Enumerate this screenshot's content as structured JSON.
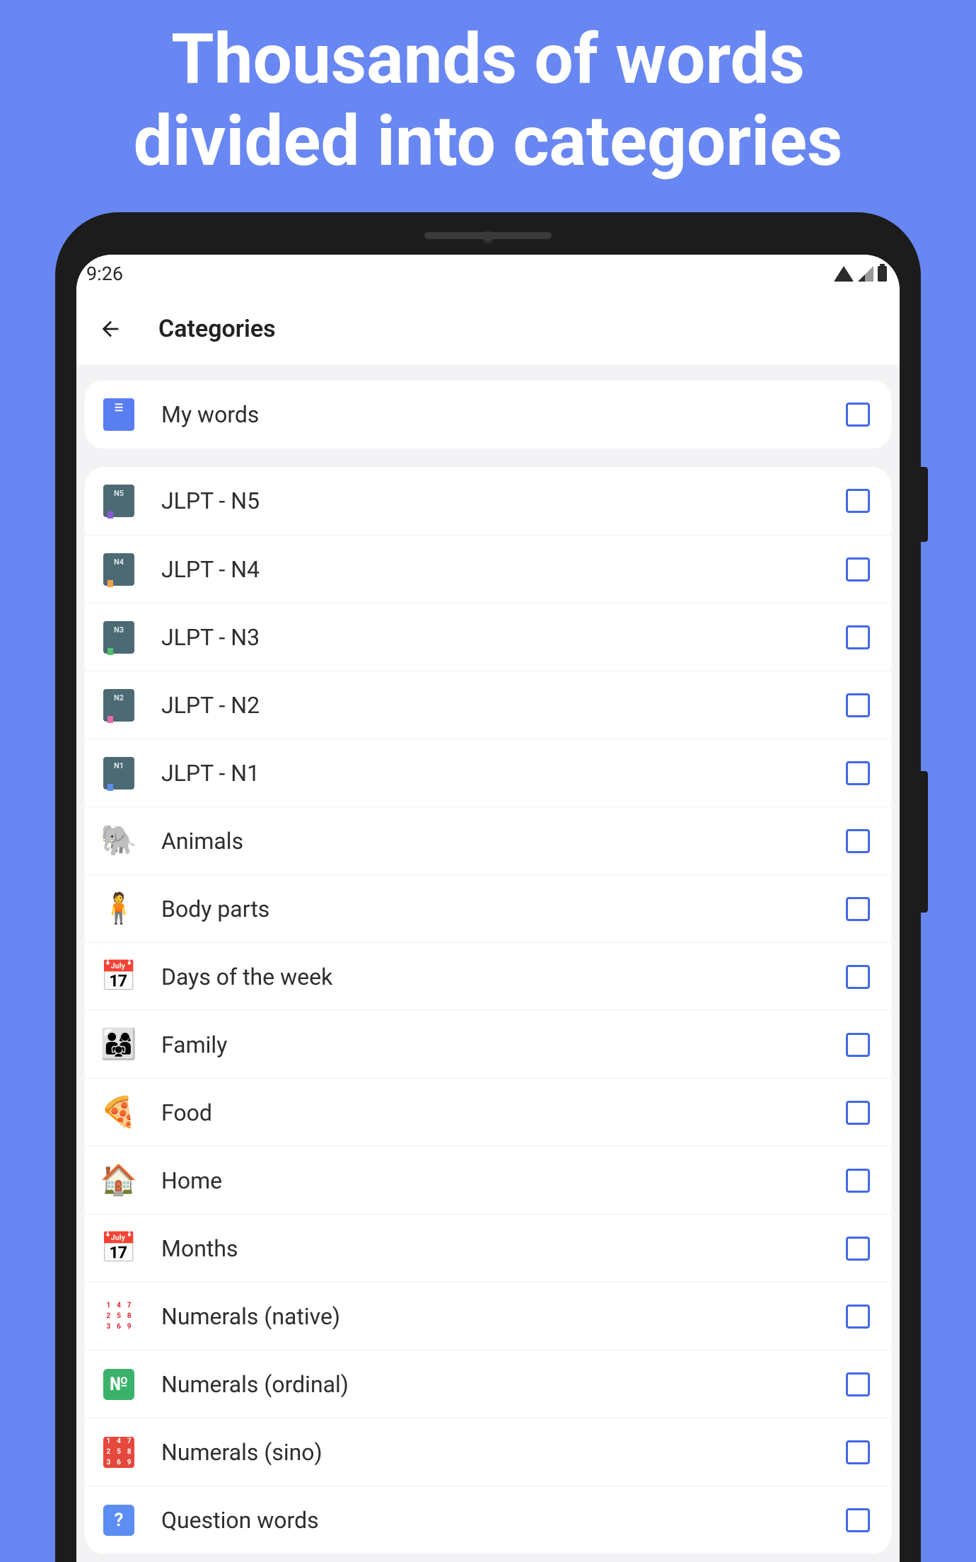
{
  "hero": {
    "line1": "Thousands of words",
    "line2": "divided into categories"
  },
  "statusbar": {
    "time": "9:26"
  },
  "appbar": {
    "title": "Categories"
  },
  "my_words": {
    "label": "My words"
  },
  "categories": [
    {
      "label": "JLPT - N5",
      "icon_type": "book",
      "book_text": "N5",
      "ribbon": "purple"
    },
    {
      "label": "JLPT - N4",
      "icon_type": "book",
      "book_text": "N4",
      "ribbon": "orange"
    },
    {
      "label": "JLPT - N3",
      "icon_type": "book",
      "book_text": "N3",
      "ribbon": "green"
    },
    {
      "label": "JLPT - N2",
      "icon_type": "book",
      "book_text": "N2",
      "ribbon": "pink"
    },
    {
      "label": "JLPT - N1",
      "icon_type": "book",
      "book_text": "N1",
      "ribbon": "blue2"
    },
    {
      "label": "Animals",
      "icon_type": "emoji",
      "emoji": "🐘"
    },
    {
      "label": "Body parts",
      "icon_type": "emoji",
      "emoji": "🧍"
    },
    {
      "label": "Days of the week",
      "icon_type": "emoji",
      "emoji": "📅"
    },
    {
      "label": "Family",
      "icon_type": "emoji",
      "emoji": "👨‍👩‍👧"
    },
    {
      "label": "Food",
      "icon_type": "emoji",
      "emoji": "🍕"
    },
    {
      "label": "Home",
      "icon_type": "emoji",
      "emoji": "🏠"
    },
    {
      "label": "Months",
      "icon_type": "emoji",
      "emoji": "📅"
    },
    {
      "label": "Numerals (native)",
      "icon_type": "numgrid",
      "bg": "#fff",
      "fg": "#d23"
    },
    {
      "label": "Numerals (ordinal)",
      "icon_type": "numbox",
      "bg": "#3bb26a",
      "text": "№"
    },
    {
      "label": "Numerals (sino)",
      "icon_type": "numgrid",
      "bg": "#e5483d",
      "fg": "#fff"
    },
    {
      "label": "Question words",
      "icon_type": "numbox",
      "bg": "#5b8df2",
      "text": "?"
    }
  ]
}
